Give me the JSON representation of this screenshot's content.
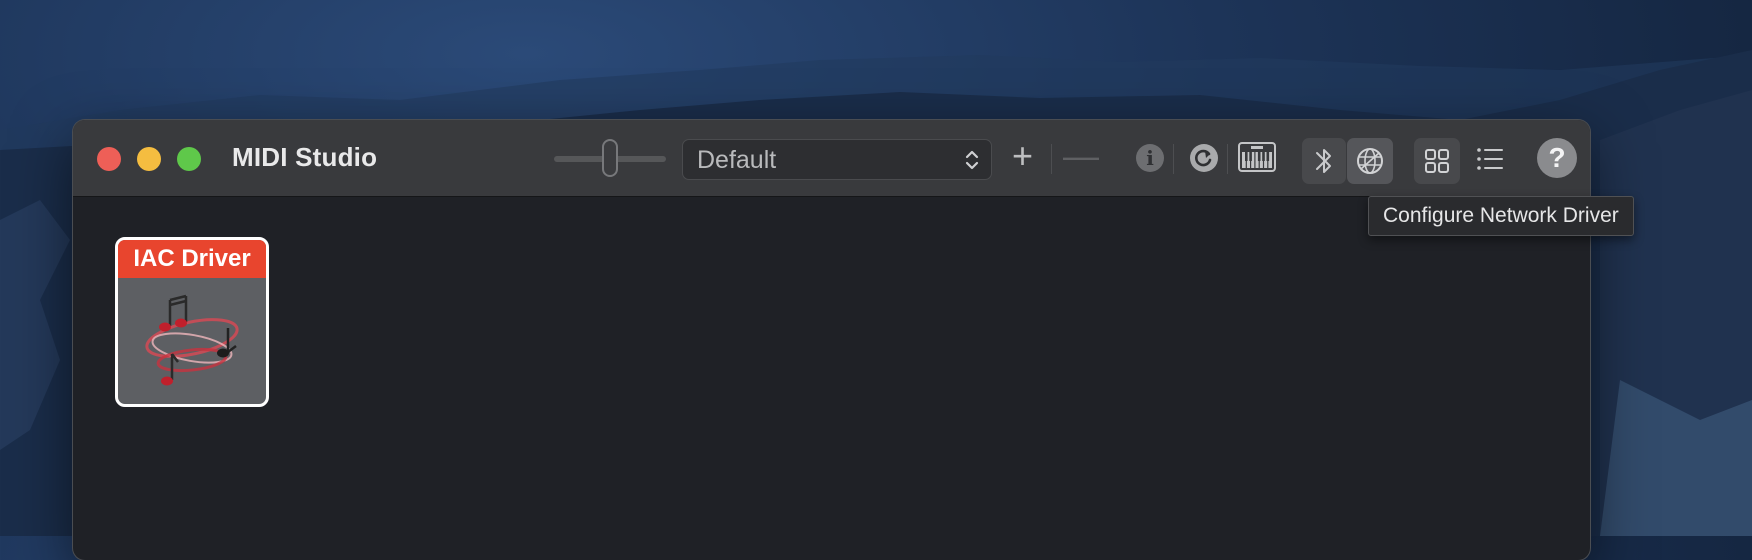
{
  "window": {
    "title": "MIDI Studio"
  },
  "toolbar": {
    "configuration": "Default",
    "add_label": "+",
    "remove_label": "—",
    "info_label": "i",
    "help_label": "?",
    "icons": {
      "slider": "icon-size-slider",
      "add": "plus-icon",
      "remove": "minus-icon",
      "info": "info-icon",
      "rescan": "rescan-icon",
      "keyboard": "midi-keyboard-icon",
      "bluetooth": "bluetooth-icon",
      "network": "globe-icon",
      "icon_view": "grid-icon",
      "list_view": "list-icon",
      "help": "help-icon"
    }
  },
  "tooltip": "Configure Network Driver",
  "devices": [
    {
      "name": "IAC Driver",
      "icon": "music-notes-swirl-icon"
    }
  ],
  "colors": {
    "close": "#ee5f57",
    "minimize": "#f5bd40",
    "zoom": "#5fc84a",
    "device_header": "#e8452e"
  }
}
